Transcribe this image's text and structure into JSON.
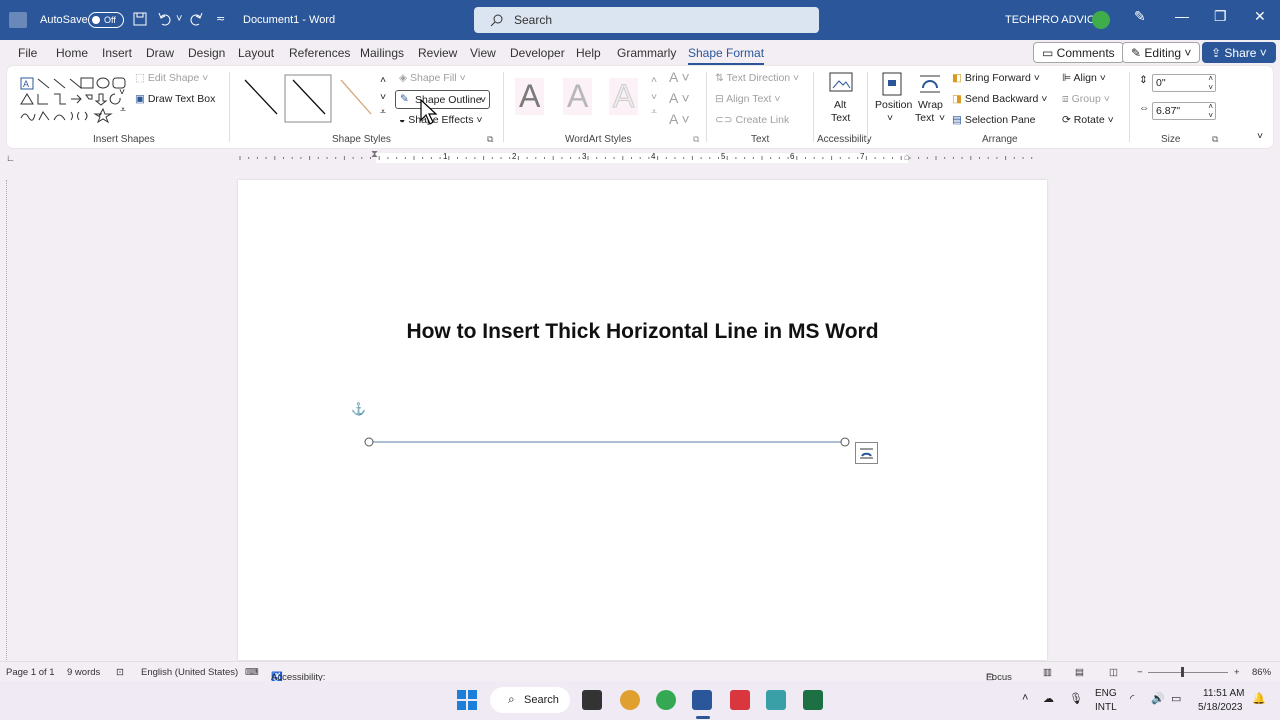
{
  "window": {
    "autosave": "AutoSave",
    "toggle": "Off",
    "doc_title": "Document1 - Word",
    "search_placeholder": "Search",
    "account": "TECHPRO ADVICE"
  },
  "tabs": [
    "File",
    "Home",
    "Insert",
    "Draw",
    "Design",
    "Layout",
    "References",
    "Mailings",
    "Review",
    "View",
    "Developer",
    "Help",
    "Grammarly",
    "Shape Format"
  ],
  "tab_actions": {
    "comments": "Comments",
    "editing": "Editing",
    "share": "Share"
  },
  "ribbon": {
    "insert_shapes": {
      "label": "Insert Shapes",
      "edit_shape": "Edit Shape",
      "draw_text_box": "Draw Text Box"
    },
    "shape_styles": {
      "label": "Shape Styles",
      "shape_fill": "Shape Fill",
      "shape_outline": "Shape Outline",
      "shape_effects": "Shape Effects"
    },
    "wordart": {
      "label": "WordArt Styles",
      "letter": "A"
    },
    "text": {
      "label": "Text",
      "text_direction": "Text Direction",
      "align_text": "Align Text",
      "create_link": "Create Link"
    },
    "accessibility": {
      "label": "Accessibility",
      "alt_text_1": "Alt",
      "alt_text_2": "Text"
    },
    "arrange": {
      "label": "Arrange",
      "position": "Position",
      "wrap_1": "Wrap",
      "wrap_2": "Text",
      "bring_forward": "Bring Forward",
      "send_backward": "Send Backward",
      "selection_pane": "Selection Pane",
      "align": "Align",
      "group": "Group",
      "rotate": "Rotate"
    },
    "size": {
      "label": "Size",
      "height": "0\"",
      "width": "6.87\""
    }
  },
  "ruler": {
    "marks": [
      "1",
      "2",
      "3",
      "4",
      "5",
      "6",
      "7"
    ]
  },
  "document": {
    "title": "How to Insert Thick Horizontal Line in MS Word"
  },
  "status": {
    "page": "Page 1 of 1",
    "words": "9 words",
    "language": "English (United States)",
    "accessibility": "Accessibility: Investigate",
    "focus": "Focus",
    "zoom": "86%"
  },
  "taskbar": {
    "search": "Search",
    "lang_1": "ENG",
    "lang_2": "INTL",
    "time": "11:51 AM",
    "date": "5/18/2023"
  },
  "colors": {
    "brand": "#2b579a",
    "line": "#5b7fa6"
  }
}
